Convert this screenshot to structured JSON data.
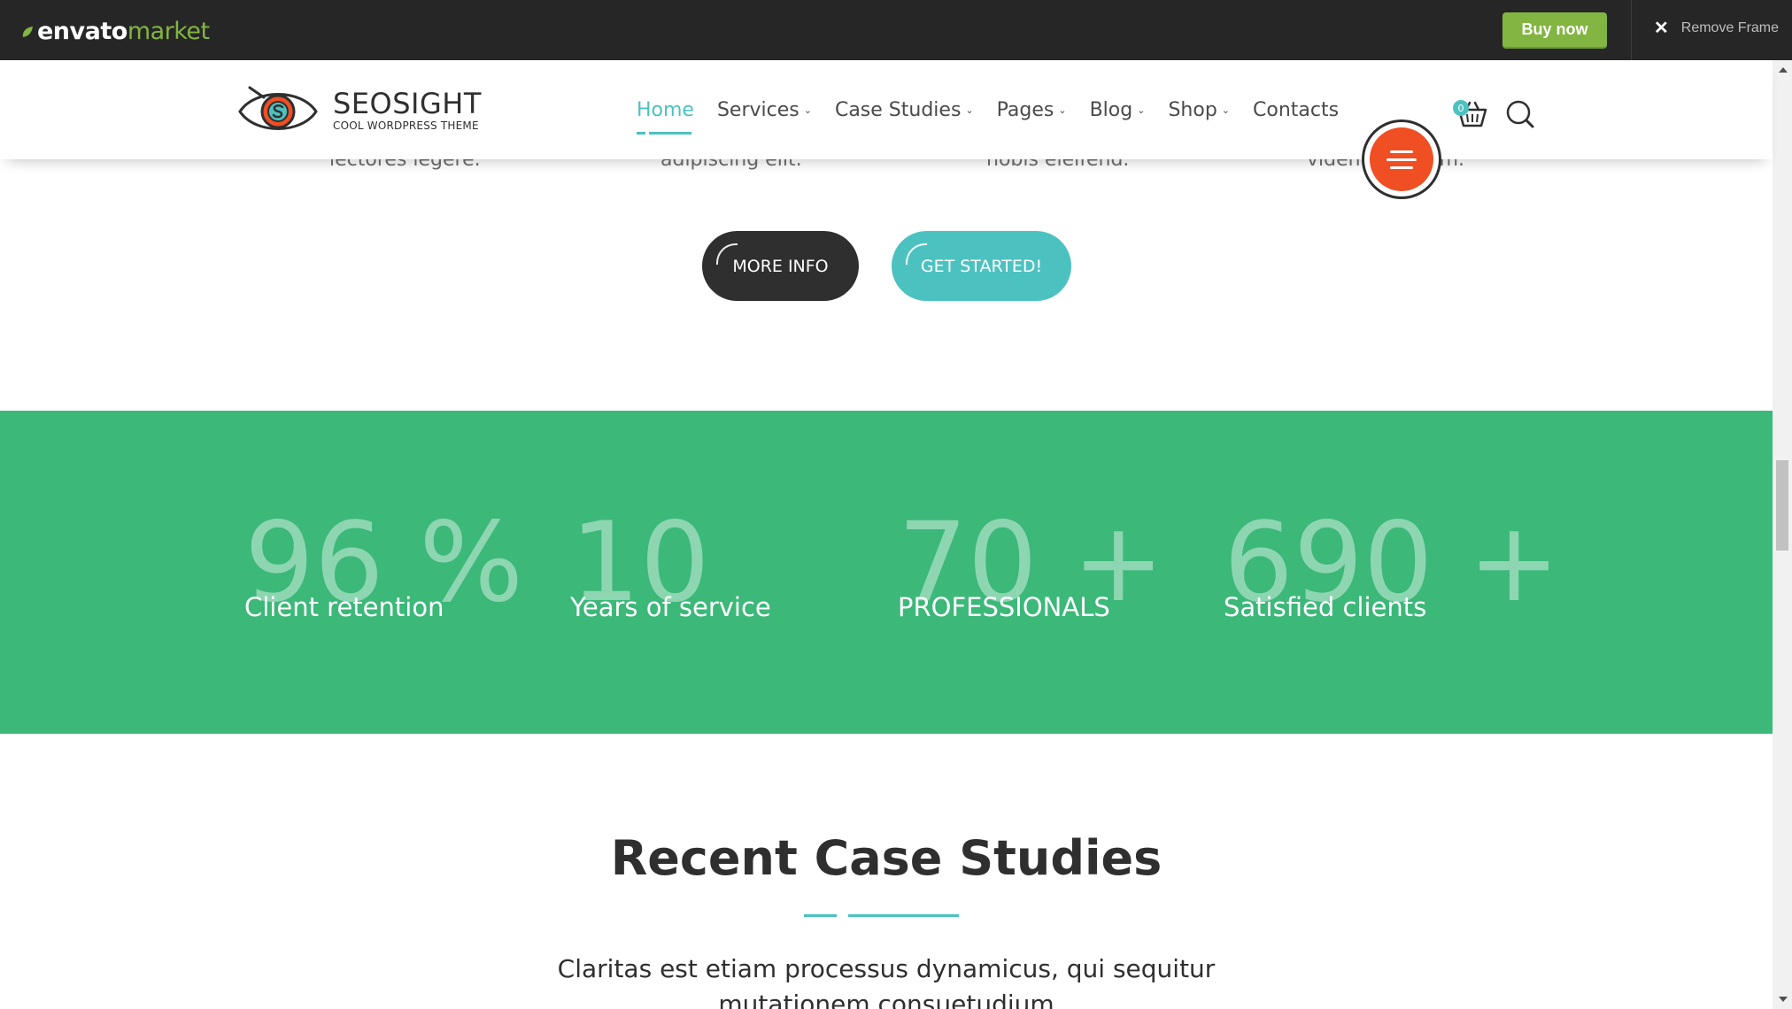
{
  "envato_bar": {
    "logo_word1": "envato",
    "logo_word2": "market",
    "buy_now": "Buy now",
    "remove_frame": "Remove Frame",
    "close_glyph": "✕",
    "background": "#262626",
    "accent": "#82b541"
  },
  "header": {
    "brand_name": "SEOSIGHT",
    "brand_tagline": "COOL WORDPRESS THEME",
    "nav": [
      {
        "label": "Home",
        "active": true,
        "dropdown": false
      },
      {
        "label": "Services",
        "dropdown": true
      },
      {
        "label": "Case Studies",
        "dropdown": true
      },
      {
        "label": "Pages",
        "dropdown": true
      },
      {
        "label": "Blog",
        "dropdown": true
      },
      {
        "label": "Shop",
        "dropdown": true
      },
      {
        "label": "Contacts",
        "dropdown": false
      }
    ],
    "chevron": "⌄",
    "cart_count": "0",
    "icons": [
      "cart-icon",
      "search-icon",
      "menu-icon"
    ]
  },
  "features": {
    "snippets": [
      "lectores legere.",
      "adipiscing elit.",
      "nobis eleifend.",
      "videntur parum."
    ]
  },
  "buttons": {
    "more_info": "MORE INFO",
    "get_started": "GET STARTED!"
  },
  "stats": {
    "background": "#3cb879",
    "items": [
      {
        "number": "96 %",
        "label": "Client retention"
      },
      {
        "number": "10",
        "label": "Years of service"
      },
      {
        "number": "70 +",
        "label": "PROFESSIONALS"
      },
      {
        "number": "690 +",
        "label": "Satisfied clients"
      }
    ]
  },
  "case_studies": {
    "title": "Recent Case Studies",
    "description": "Claritas est etiam processus dynamicus, qui sequitur mutationem consuetudium"
  },
  "colors": {
    "teal": "#4cc2c0",
    "dark": "#2f2f2f",
    "orange": "#f04e23",
    "green": "#3cb879"
  }
}
